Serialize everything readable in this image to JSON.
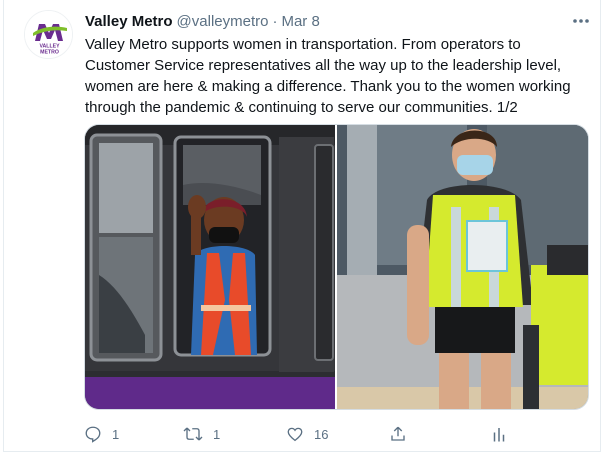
{
  "tweet": {
    "author_name": "Valley Metro",
    "handle": "@valleymetro",
    "separator": "·",
    "date": "Mar 8",
    "avatar_logo_text": "VALLEY METRO",
    "text": "Valley Metro supports women in transportation. From operators to Customer Service representatives all the way up to the leadership level, women are here & making a difference. Thank you to the women working through the pandemic & continuing to serve our communities. 1/2"
  },
  "media": {
    "photos": [
      {
        "name": "bus-operator-photo",
        "icon": "photo"
      },
      {
        "name": "light-rail-staff-photo",
        "icon": "photo"
      }
    ]
  },
  "actions": {
    "reply_count": "1",
    "retweet_count": "1",
    "like_count": "16"
  },
  "icons": {
    "reply": "reply-icon",
    "retweet": "retweet-icon",
    "like": "like-icon",
    "share": "share-icon",
    "analytics": "analytics-icon",
    "more": "more-icon"
  },
  "colors": {
    "brand_green": "#7fbf2a",
    "brand_purple": "#6a2c8f",
    "secondary_text": "#5b7083",
    "border": "#e6ecf0"
  }
}
